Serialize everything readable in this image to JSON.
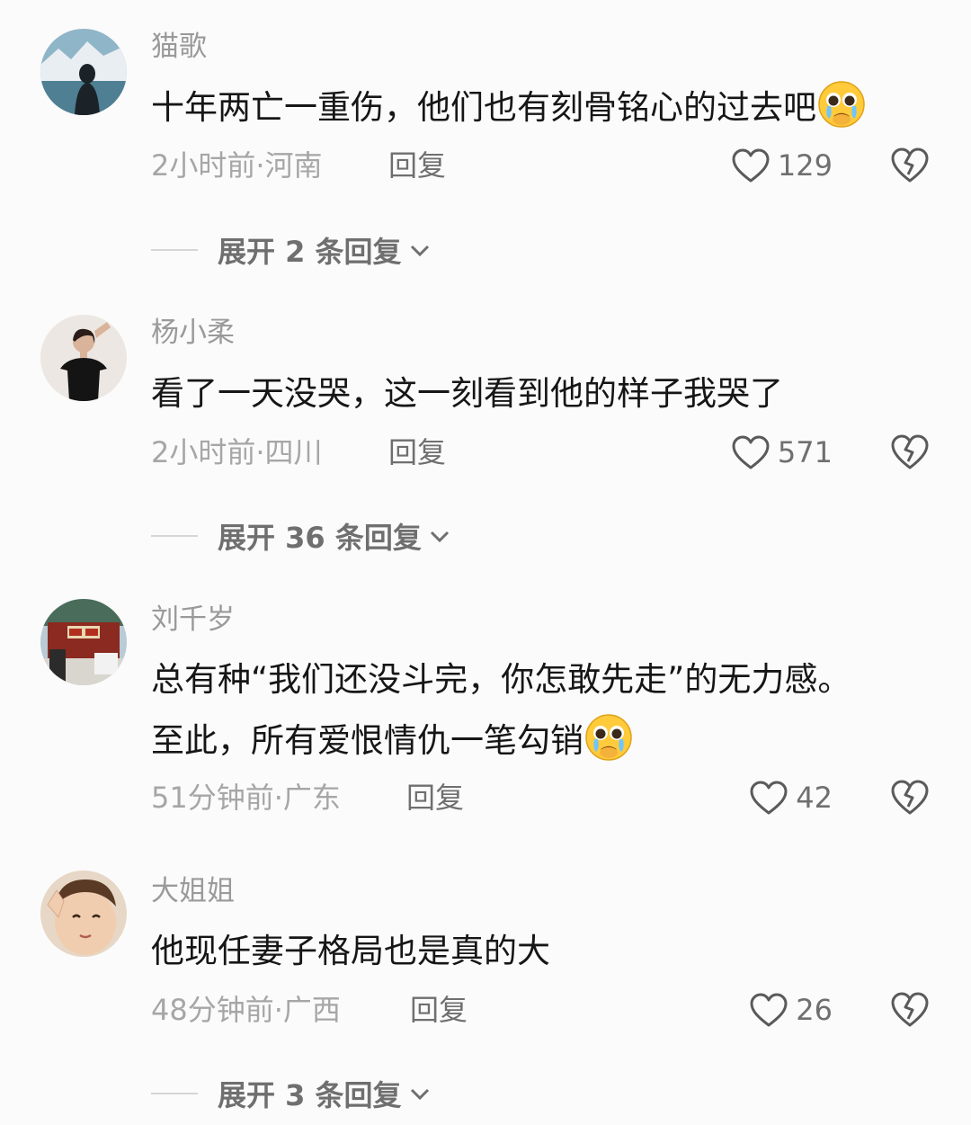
{
  "comments": [
    {
      "username": "猫歌",
      "lines": [
        "十年两亡一重伤，他们也有刻骨铭心的过去吧"
      ],
      "emoji": "pleading-face-icon",
      "meta": "2小时前·河南",
      "reply_label": "回复",
      "likes": "129",
      "expand_label": "展开 2 条回复"
    },
    {
      "username": "杨小柔",
      "lines": [
        "看了一天没哭，这一刻看到他的样子我哭了"
      ],
      "meta": "2小时前·四川",
      "reply_label": "回复",
      "likes": "571",
      "expand_label": "展开 36 条回复"
    },
    {
      "username": "刘千岁",
      "lines": [
        "总有种“我们还没斗完，你怎敢先走”的无力感。",
        "至此，所有爱恨情仇一笔勾销"
      ],
      "emoji": "pleading-face-icon",
      "meta": "51分钟前·广东",
      "reply_label": "回复",
      "likes": "42"
    },
    {
      "username": "大姐姐",
      "lines": [
        "他现任妻子格局也是真的大"
      ],
      "meta": "48分钟前·广西",
      "reply_label": "回复",
      "likes": "26",
      "expand_label": "展开 3 条回复"
    }
  ]
}
